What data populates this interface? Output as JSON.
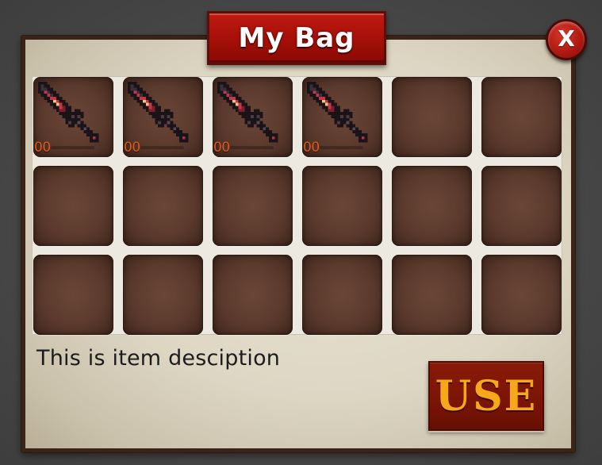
{
  "window": {
    "title": "My Bag",
    "close_label": "X"
  },
  "inventory": {
    "columns": 6,
    "rows": 3,
    "slots": [
      {
        "item": "sword-icon",
        "count": "00"
      },
      {
        "item": "sword-icon",
        "count": "00"
      },
      {
        "item": "sword-icon",
        "count": "00"
      },
      {
        "item": "sword-icon",
        "count": "00"
      },
      {
        "item": null,
        "count": null
      },
      {
        "item": null,
        "count": null
      },
      {
        "item": null,
        "count": null
      },
      {
        "item": null,
        "count": null
      },
      {
        "item": null,
        "count": null
      },
      {
        "item": null,
        "count": null
      },
      {
        "item": null,
        "count": null
      },
      {
        "item": null,
        "count": null
      },
      {
        "item": null,
        "count": null
      },
      {
        "item": null,
        "count": null
      },
      {
        "item": null,
        "count": null
      },
      {
        "item": null,
        "count": null
      },
      {
        "item": null,
        "count": null
      },
      {
        "item": null,
        "count": null
      }
    ]
  },
  "description": "This is item desciption",
  "actions": {
    "use_label": "USE"
  },
  "colors": {
    "banner_red": "#a40f08",
    "close_red": "#b01a12",
    "slot_brown": "#5b3a2d",
    "panel_parchment": "#ddd6c3",
    "use_bg": "#7a1405",
    "use_text": "#f7a81a",
    "count_orange": "#e0581c"
  }
}
